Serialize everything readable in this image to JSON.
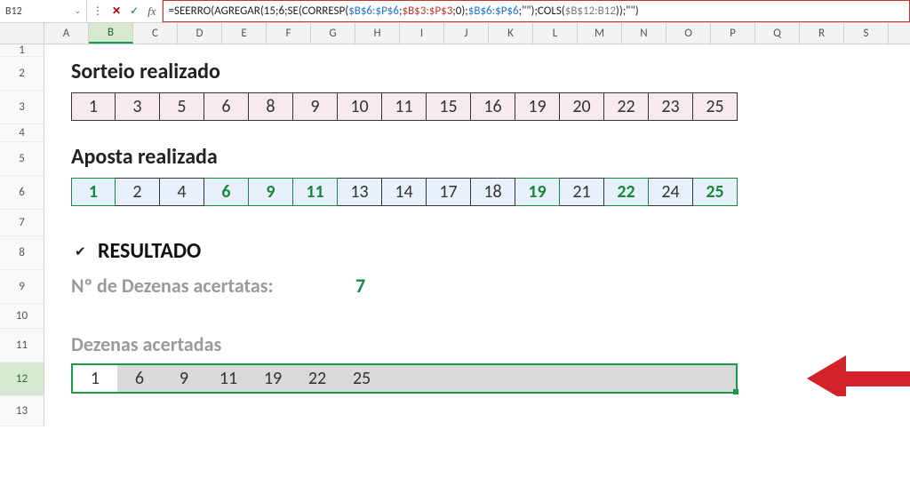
{
  "namebox": {
    "value": "B12"
  },
  "formula": {
    "p1": "=SEERRO(AGREGAR(15;6;SE(CORRESP(",
    "r1": "$B$6:$P$6",
    "sep1": ";",
    "r2": "$B$3:$P$3",
    "p2": ";0);",
    "r3": "$B$6:$P$6",
    "p3": ";\"\");COLS(",
    "r4": "$B$12:B12",
    "p4": "));\"\")"
  },
  "columns": [
    "A",
    "B",
    "C",
    "D",
    "E",
    "F",
    "G",
    "H",
    "I",
    "J",
    "K",
    "L",
    "M",
    "N",
    "O",
    "P",
    "Q",
    "R",
    "S"
  ],
  "selectedCol": "B",
  "rows": [
    "1",
    "2",
    "3",
    "4",
    "5",
    "6",
    "7",
    "8",
    "9",
    "10",
    "11",
    "12",
    "13"
  ],
  "selectedRow": "12",
  "labels": {
    "sorteio": "Sorteio realizado",
    "aposta": "Aposta realizada",
    "resultado": "RESULTADO",
    "ndezenas": "Nº de Dezenas acertatas:",
    "ndezenas_valor": "7",
    "dezacert": "Dezenas acertadas",
    "check": "✔"
  },
  "sorteio": [
    "1",
    "3",
    "5",
    "6",
    "8",
    "9",
    "10",
    "11",
    "15",
    "16",
    "19",
    "20",
    "22",
    "23",
    "25"
  ],
  "aposta": [
    "1",
    "2",
    "4",
    "6",
    "9",
    "11",
    "13",
    "14",
    "17",
    "18",
    "19",
    "21",
    "22",
    "24",
    "25"
  ],
  "aposta_hits": [
    true,
    false,
    false,
    true,
    true,
    true,
    false,
    false,
    false,
    false,
    true,
    false,
    true,
    false,
    true
  ],
  "acertadas": [
    "1",
    "6",
    "9",
    "11",
    "19",
    "22",
    "25"
  ],
  "icons": {
    "cancel": "✕",
    "confirm": "✓",
    "fx": "fx",
    "chevron": "⌄",
    "ellipsis": "⋮"
  }
}
